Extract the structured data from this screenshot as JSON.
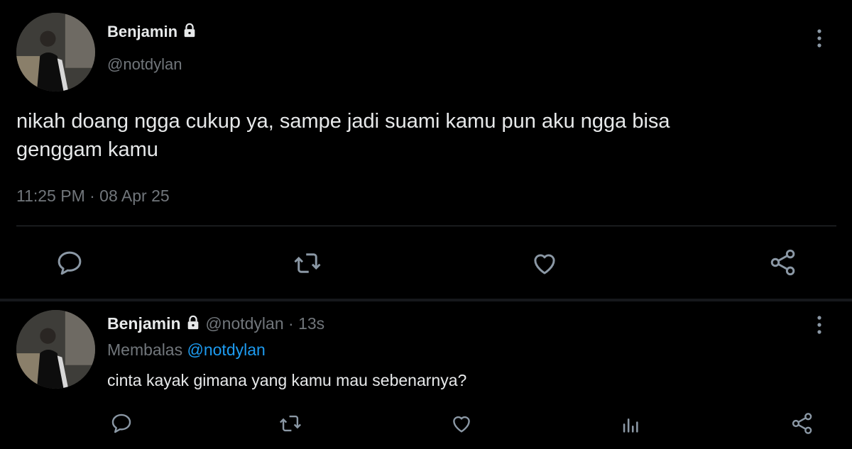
{
  "main_tweet": {
    "display_name": "Benjamin",
    "handle": "@notdylan",
    "text_line1": "nikah doang ngga cukup ya, sampe jadi suami kamu pun aku ngga bisa",
    "text_line2": "genggam kamu",
    "timestamp": "11:25 PM · 08 Apr 25",
    "actions": [
      "reply-icon",
      "retweet-icon",
      "like-icon",
      "share-icon"
    ]
  },
  "reply_tweet": {
    "display_name": "Benjamin",
    "handle": "@notdylan",
    "time_ago": "13s",
    "replying_prefix": "Membalas",
    "replying_to": "@notdylan",
    "text": "cinta kayak gimana yang kamu mau sebenarnya?",
    "actions": [
      "reply-icon",
      "retweet-icon",
      "like-icon",
      "analytics-icon",
      "share-icon"
    ]
  },
  "colors": {
    "background": "#000000",
    "text": "#e7e9ea",
    "muted": "#71767b",
    "link": "#1d9bf0",
    "divider": "#2f3336"
  }
}
